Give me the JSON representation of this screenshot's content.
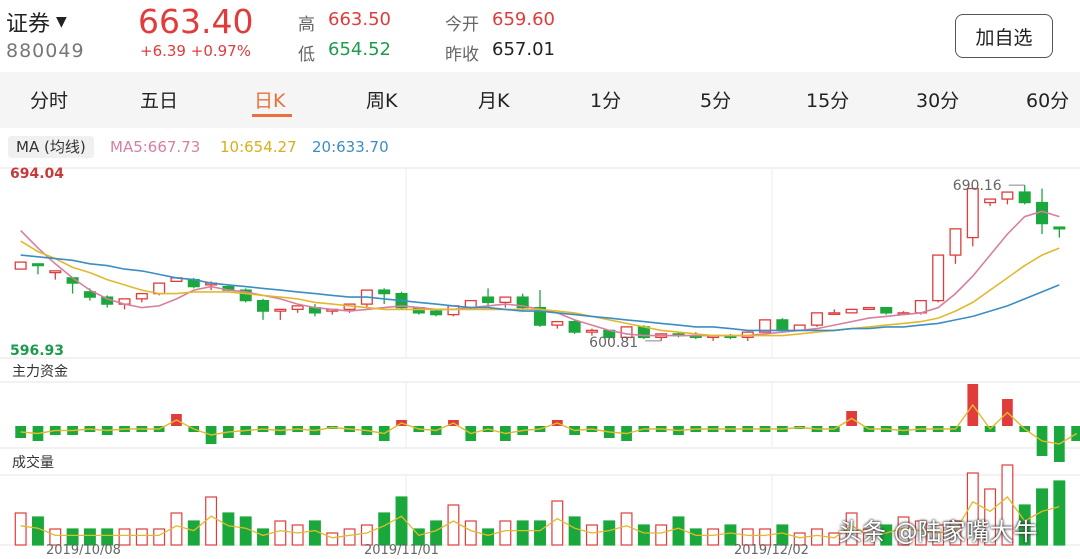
{
  "stock": {
    "name": "证券",
    "code": "880049",
    "price": "663.40",
    "change": "+6.39",
    "change_pct": "+0.97%",
    "high_label": "高",
    "high": "663.50",
    "low_label": "低",
    "low": "654.52",
    "open_label": "今开",
    "open": "659.60",
    "prev_label": "昨收",
    "prev_close": "657.01",
    "favorite_label": "加自选"
  },
  "tabs": [
    "分时",
    "五日",
    "日K",
    "周K",
    "月K",
    "1分",
    "5分",
    "15分",
    "30分",
    "60分"
  ],
  "active_tab": "日K",
  "ma": {
    "label": "MA (均线)",
    "ma5": "MA5:667.73",
    "ma10": "10:654.27",
    "ma20": "20:633.70"
  },
  "panels": {
    "money_flow": "主力资金",
    "volume": "成交量"
  },
  "colors": {
    "up": "#e03c3c",
    "down": "#1aa83c",
    "ma5": "#d77fa0",
    "ma10": "#e2b92d",
    "ma20": "#3b8ec4",
    "accent": "#e8703a"
  },
  "chart_data": {
    "type": "candlestick",
    "y_max_label": "694.04",
    "y_min_label": "596.93",
    "ylim": [
      596.93,
      694.04
    ],
    "max_marker": "690.16",
    "min_marker": "600.81",
    "dates": [
      "2019/10/08",
      "2019/11/01",
      "2019/12/02"
    ],
    "candles": [
      [
        642,
        646,
        641,
        645
      ],
      [
        645,
        644,
        640,
        639
      ],
      [
        640,
        641,
        638,
        636
      ],
      [
        637,
        634,
        637,
        628
      ],
      [
        629,
        626,
        631,
        624
      ],
      [
        626,
        622,
        627,
        620
      ],
      [
        622,
        625,
        621,
        619
      ],
      [
        625,
        628,
        624,
        623
      ],
      [
        628,
        634,
        627,
        627
      ],
      [
        635,
        637,
        634,
        640
      ],
      [
        636,
        632,
        637,
        631
      ],
      [
        633,
        634,
        635,
        630
      ],
      [
        632,
        630,
        633,
        629
      ],
      [
        630,
        624,
        631,
        623
      ],
      [
        624,
        618,
        625,
        613
      ],
      [
        618,
        619,
        618,
        613
      ],
      [
        619,
        621,
        618,
        617
      ],
      [
        620,
        617,
        622,
        615
      ],
      [
        618,
        619,
        617,
        616
      ],
      [
        619,
        622,
        618,
        617
      ],
      [
        622,
        630,
        621,
        620
      ],
      [
        630,
        628,
        631,
        622
      ],
      [
        628,
        620,
        629,
        619
      ],
      [
        620,
        617,
        620,
        616
      ],
      [
        618,
        616,
        619,
        615
      ],
      [
        616,
        621,
        615,
        615
      ],
      [
        620,
        624,
        624,
        619
      ],
      [
        626,
        623,
        631,
        620
      ],
      [
        623,
        626,
        625,
        620
      ],
      [
        626,
        620,
        628,
        618
      ],
      [
        620,
        610,
        630,
        609
      ],
      [
        610,
        612,
        609,
        608
      ],
      [
        612,
        606,
        613,
        605
      ],
      [
        606,
        607,
        608,
        604
      ],
      [
        607,
        603,
        606,
        602
      ],
      [
        603,
        609,
        602,
        602
      ],
      [
        609,
        603,
        610,
        602
      ],
      [
        603,
        605,
        602,
        601
      ],
      [
        605,
        604,
        606,
        603
      ],
      [
        604,
        603,
        606,
        602
      ],
      [
        603,
        604,
        602,
        601
      ],
      [
        604,
        603,
        605,
        602
      ],
      [
        603,
        606,
        602,
        601
      ],
      [
        606,
        613,
        606,
        610
      ],
      [
        613,
        607,
        614,
        606
      ],
      [
        607,
        610,
        608,
        607
      ],
      [
        610,
        617,
        608,
        609
      ],
      [
        617,
        617,
        619,
        616
      ],
      [
        617,
        619,
        616,
        617
      ],
      [
        619,
        620,
        618,
        619
      ],
      [
        620,
        617,
        620,
        616
      ],
      [
        617,
        617,
        618,
        617
      ],
      [
        617,
        624,
        617,
        616
      ],
      [
        624,
        650,
        623,
        623
      ],
      [
        650,
        665,
        651,
        645
      ],
      [
        660,
        688,
        660,
        655
      ],
      [
        680,
        682,
        681,
        678
      ],
      [
        682,
        686,
        681,
        679
      ],
      [
        686,
        680,
        690,
        679
      ],
      [
        680,
        668,
        688,
        662
      ],
      [
        666,
        665,
        662,
        660
      ]
    ],
    "ma5": [
      664,
      654,
      645,
      637,
      630,
      625,
      622,
      620,
      621,
      625,
      630,
      632,
      630,
      629,
      627,
      625,
      622,
      620,
      619,
      618,
      619,
      620,
      621,
      620,
      619,
      619,
      620,
      621,
      622,
      621,
      619,
      617,
      613,
      610,
      607,
      605,
      604,
      604,
      604,
      604,
      604,
      604,
      604,
      605,
      606,
      607,
      608,
      610,
      612,
      614,
      615,
      616,
      617,
      620,
      628,
      638,
      650,
      662,
      672,
      675,
      672
    ],
    "ma10": [
      658,
      652,
      648,
      643,
      640,
      636,
      633,
      630,
      628,
      628,
      629,
      629,
      629,
      628,
      627,
      626,
      625,
      623,
      622,
      621,
      620,
      619,
      619,
      619,
      619,
      619,
      619,
      619,
      619,
      619,
      619,
      618,
      617,
      615,
      613,
      611,
      609,
      607,
      606,
      605,
      604,
      604,
      604,
      604,
      604,
      605,
      606,
      607,
      608,
      609,
      610,
      611,
      612,
      614,
      618,
      623,
      630,
      637,
      644,
      650,
      654
    ],
    "ma20": [
      650,
      649,
      648,
      647,
      645,
      644,
      642,
      641,
      639,
      637,
      636,
      634,
      633,
      632,
      631,
      630,
      629,
      628,
      627,
      626,
      626,
      625,
      624,
      623,
      622,
      621,
      620,
      620,
      619,
      618,
      618,
      617,
      616,
      615,
      614,
      613,
      612,
      611,
      610,
      609,
      609,
      608,
      607,
      607,
      607,
      607,
      607,
      607,
      608,
      608,
      609,
      609,
      610,
      611,
      613,
      615,
      618,
      621,
      625,
      629,
      633
    ],
    "money_flow": [
      -4,
      -5,
      -3,
      -3,
      -2,
      -3,
      -2,
      -2,
      -2,
      4,
      -2,
      -6,
      -4,
      -3,
      -2,
      -3,
      -2,
      -3,
      -1,
      -2,
      -3,
      -5,
      2,
      -2,
      -3,
      2,
      -5,
      -2,
      -5,
      -3,
      -2,
      2,
      -3,
      -2,
      -4,
      -5,
      -2,
      -2,
      -3,
      -2,
      -2,
      -2,
      -2,
      -2,
      -2,
      -1,
      -2,
      -2,
      5,
      -2,
      -2,
      -3,
      -2,
      -2,
      -2,
      14,
      -2,
      9,
      -2,
      -10,
      -12,
      -5
    ],
    "volume": [
      8,
      7,
      4,
      4,
      4,
      4,
      4,
      4,
      4,
      8,
      6,
      12,
      8,
      7,
      4,
      6,
      5,
      6,
      3,
      4,
      5,
      8,
      12,
      4,
      6,
      10,
      6,
      4,
      6,
      6,
      6,
      11,
      7,
      5,
      6,
      8,
      5,
      5,
      7,
      4,
      4,
      5,
      4,
      4,
      5,
      3,
      4,
      3,
      8,
      4,
      5,
      7,
      6,
      5,
      6,
      18,
      14,
      20,
      10,
      14,
      16,
      12
    ]
  },
  "watermark": "头条 @陆家嘴大牛"
}
